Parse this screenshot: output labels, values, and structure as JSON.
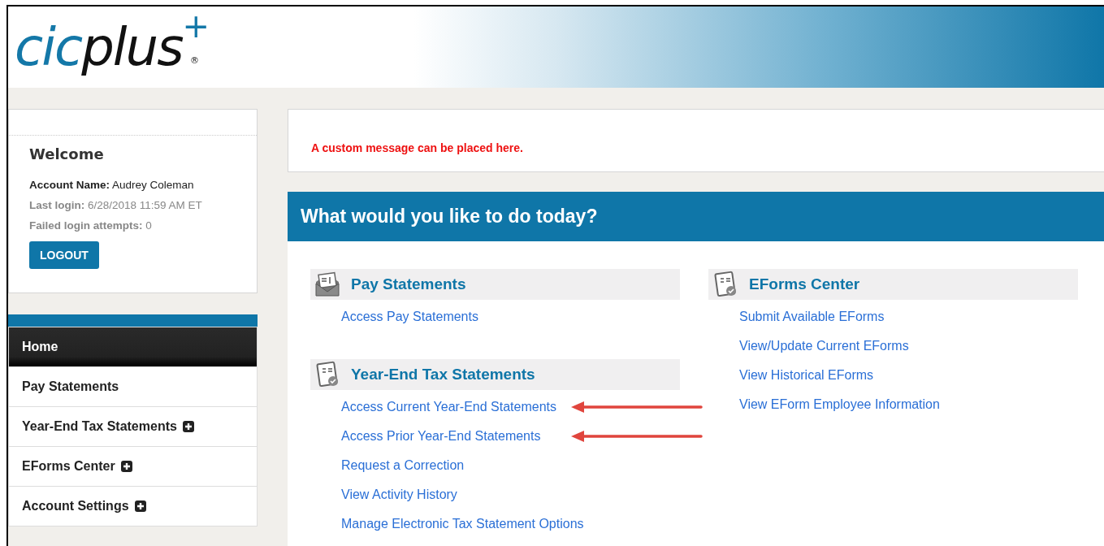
{
  "logo": {
    "part_1": "cic",
    "part_2": "plus",
    "plus_mark": "+",
    "registered": "®"
  },
  "welcome": {
    "title": "Welcome",
    "account_label": "Account Name:",
    "account_name": "Audrey Coleman",
    "last_login_label": "Last login:",
    "last_login": "6/28/2018 11:59 AM ET",
    "failed_label": "Failed login attempts:",
    "failed": "0",
    "logout": "LOGOUT"
  },
  "nav": [
    {
      "label": "Home",
      "selected": true,
      "expandable": false
    },
    {
      "label": "Pay Statements",
      "selected": false,
      "expandable": false
    },
    {
      "label": "Year-End Tax Statements",
      "selected": false,
      "expandable": true
    },
    {
      "label": "EForms Center",
      "selected": false,
      "expandable": true
    },
    {
      "label": "Account Settings",
      "selected": false,
      "expandable": true
    }
  ],
  "message": "A custom message can be placed here.",
  "banner": "What would you like to do today?",
  "columns": [
    [
      {
        "title": "Pay Statements",
        "links": [
          {
            "label": "Access Pay Statements",
            "arrow": false
          }
        ]
      },
      {
        "title": "Year-End Tax Statements",
        "links": [
          {
            "label": "Access Current Year-End Statements",
            "arrow": true
          },
          {
            "label": "Access Prior Year-End Statements",
            "arrow": true
          },
          {
            "label": "Request a Correction",
            "arrow": false
          },
          {
            "label": "View Activity History",
            "arrow": false
          },
          {
            "label": "Manage Electronic Tax Statement Options",
            "arrow": false
          }
        ]
      }
    ],
    [
      {
        "title": "EForms Center",
        "links": [
          {
            "label": "Submit Available EForms",
            "arrow": false
          },
          {
            "label": "View/Update Current EForms",
            "arrow": false
          },
          {
            "label": "View Historical EForms",
            "arrow": false
          },
          {
            "label": "View EForm Employee Information",
            "arrow": false
          }
        ]
      }
    ]
  ]
}
